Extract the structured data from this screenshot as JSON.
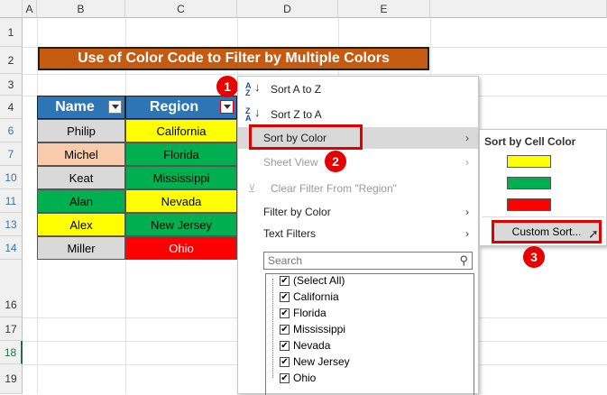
{
  "columns": [
    "A",
    "B",
    "C",
    "D",
    "E"
  ],
  "rows": [
    "1",
    "2",
    "3",
    "4",
    "6",
    "7",
    "10",
    "11",
    "13",
    "14",
    "16",
    "17",
    "18",
    "19"
  ],
  "title": "Use of Color Code to Filter by Multiple Colors",
  "table": {
    "headers": [
      "Name",
      "Region"
    ],
    "rows": [
      {
        "name": "Philip",
        "region": "California",
        "name_color": "#d9d9d9",
        "region_color": "#ffff00"
      },
      {
        "name": "Michel",
        "region": "Florida",
        "name_color": "#f8cbad",
        "region_color": "#00b050"
      },
      {
        "name": "Keat",
        "region": "Mississippi",
        "name_color": "#d9d9d9",
        "region_color": "#00b050"
      },
      {
        "name": "Alan",
        "region": "Nevada",
        "name_color": "#00b050",
        "region_color": "#ffff00"
      },
      {
        "name": "Alex",
        "region": "New Jersey",
        "name_color": "#ffff00",
        "region_color": "#00b050"
      },
      {
        "name": "Miller",
        "region": "Ohio",
        "name_color": "#d9d9d9",
        "region_color": "#ff0000"
      }
    ]
  },
  "menu": {
    "sort_az": "Sort A to Z",
    "sort_za": "Sort Z to A",
    "sort_by_color": "Sort by Color",
    "sheet_view": "Sheet View",
    "clear_filter": "Clear Filter From \"Region\"",
    "filter_by_color": "Filter by Color",
    "text_filters": "Text Filters",
    "search_placeholder": "Search",
    "list_items": [
      "(Select All)",
      "California",
      "Florida",
      "Mississippi",
      "Nevada",
      "New Jersey",
      "Ohio"
    ]
  },
  "submenu": {
    "heading": "Sort by Cell Color",
    "colors": [
      "#ffff00",
      "#00b050",
      "#ff0000"
    ],
    "custom_sort": "Custom Sort..."
  },
  "badges": [
    "1",
    "2",
    "3"
  ]
}
